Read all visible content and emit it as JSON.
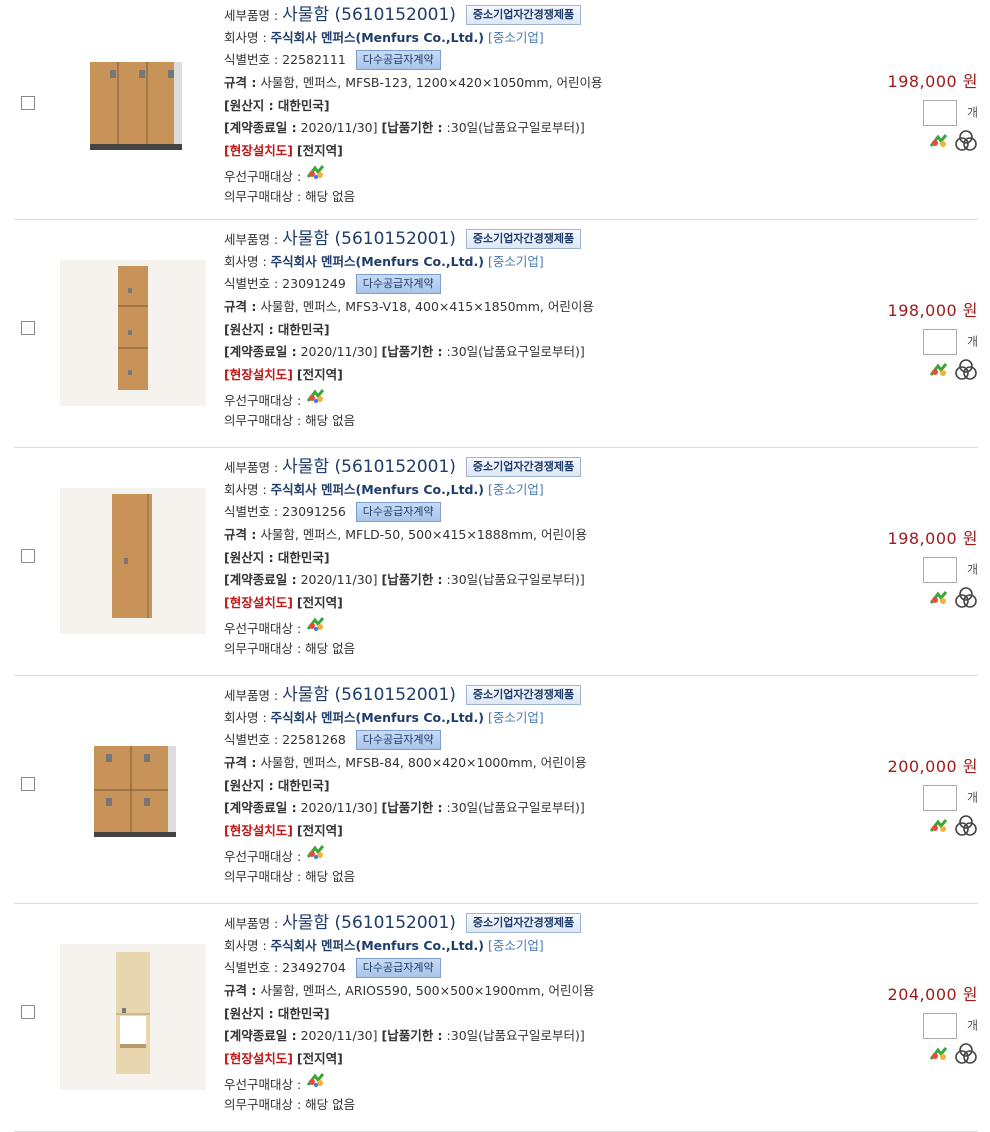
{
  "labels": {
    "detail_item": "세부품명 :",
    "company": "회사명 :",
    "ident": "식별번호 :",
    "spec": "규격 :",
    "origin": "[원산지 : 대한민국]",
    "contract_end": "[계약종료일 :",
    "delivery": "[납품기한 :",
    "onsite": "[현장설치도]",
    "region": "[전지역]",
    "priority": "우선구매대상 :",
    "mandatory": "의무구매대상 :",
    "unit": "개"
  },
  "icons": {
    "priority": "green-product-icon",
    "compare": "compare-icon",
    "cart": "cart-icon"
  },
  "colors": {
    "title": "#1e3d6b",
    "price": "#9e1a1a",
    "onsite": "#c01818",
    "sme": "#4a7ab5"
  },
  "products": [
    {
      "title": "사물함 (5610152001)",
      "compete_badge": "중소기업자간경쟁제품",
      "company": "주식회사 멘퍼스(Menfurs Co.,Ltd.)",
      "company_type": "[중소기업]",
      "ident_no": "22582111",
      "multi_badge": "다수공급자계약",
      "spec": "사물함, 멘퍼스, MFSB-123, 1200×420×1050mm, 어린이용",
      "contract_end": "2020/11/30]",
      "delivery": ":30일(납품요구일로부터)]",
      "mandatory_value": "해당 없음",
      "price": "198,000 원",
      "image": "three-door-locker"
    },
    {
      "title": "사물함 (5610152001)",
      "compete_badge": "중소기업자간경쟁제품",
      "company": "주식회사 멘퍼스(Menfurs Co.,Ltd.)",
      "company_type": "[중소기업]",
      "ident_no": "23091249",
      "multi_badge": "다수공급자계약",
      "spec": "사물함, 멘퍼스, MFS3-V18, 400×415×1850mm, 어린이용",
      "contract_end": "2020/11/30]",
      "delivery": ":30일(납품요구일로부터)]",
      "mandatory_value": "해당 없음",
      "price": "198,000 원",
      "image": "tall-three-tier-locker"
    },
    {
      "title": "사물함 (5610152001)",
      "compete_badge": "중소기업자간경쟁제품",
      "company": "주식회사 멘퍼스(Menfurs Co.,Ltd.)",
      "company_type": "[중소기업]",
      "ident_no": "23091256",
      "multi_badge": "다수공급자계약",
      "spec": "사물함, 멘퍼스, MFLD-50, 500×415×1888mm, 어린이용",
      "contract_end": "2020/11/30]",
      "delivery": ":30일(납품요구일로부터)]",
      "mandatory_value": "해당 없음",
      "price": "198,000 원",
      "image": "tall-single-door-locker"
    },
    {
      "title": "사물함 (5610152001)",
      "compete_badge": "중소기업자간경쟁제품",
      "company": "주식회사 멘퍼스(Menfurs Co.,Ltd.)",
      "company_type": "[중소기업]",
      "ident_no": "22581268",
      "multi_badge": "다수공급자계약",
      "spec": "사물함, 멘퍼스, MFSB-84, 800×420×1000mm, 어린이용",
      "contract_end": "2020/11/30]",
      "delivery": ":30일(납품요구일로부터)]",
      "mandatory_value": "해당 없음",
      "price": "200,000 원",
      "image": "four-door-locker"
    },
    {
      "title": "사물함 (5610152001)",
      "compete_badge": "중소기업자간경쟁제품",
      "company": "주식회사 멘퍼스(Menfurs Co.,Ltd.)",
      "company_type": "[중소기업]",
      "ident_no": "23492704",
      "multi_badge": "다수공급자계약",
      "spec": "사물함, 멘퍼스, ARIOS590, 500×500×1900mm, 어린이용",
      "contract_end": "2020/11/30]",
      "delivery": ":30일(납품요구일로부터)]",
      "mandatory_value": "해당 없음",
      "price": "204,000 원",
      "image": "open-shelf-locker"
    }
  ]
}
